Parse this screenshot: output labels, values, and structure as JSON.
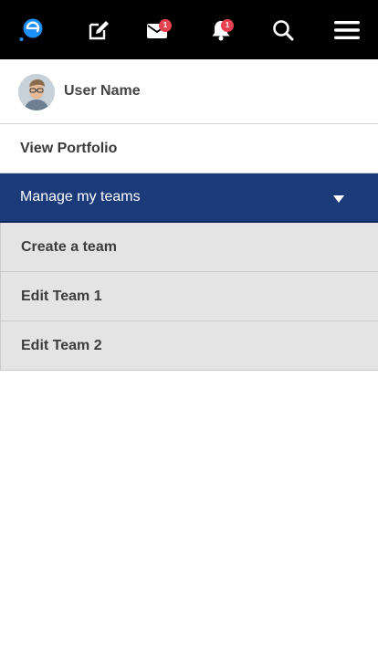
{
  "header": {
    "logo": "chat-logo-icon",
    "icons": [
      "edit-icon",
      "mail-icon",
      "bell-icon",
      "search-icon",
      "hamburger-menu-icon"
    ],
    "mail_badge": "1",
    "notification_badge": "1",
    "background_color": "#000000",
    "logo_color": "#1e8ff5",
    "badge_color": "#e8414f"
  },
  "user": {
    "name": "User Name",
    "avatar": "avatar-photo"
  },
  "menu": {
    "view_portfolio": "View Portfolio",
    "manage_teams": "Manage my teams",
    "manage_teams_color": "#1b3a7a",
    "sub_items": [
      "Create a team",
      "Edit Team 1",
      "Edit Team 2"
    ]
  }
}
